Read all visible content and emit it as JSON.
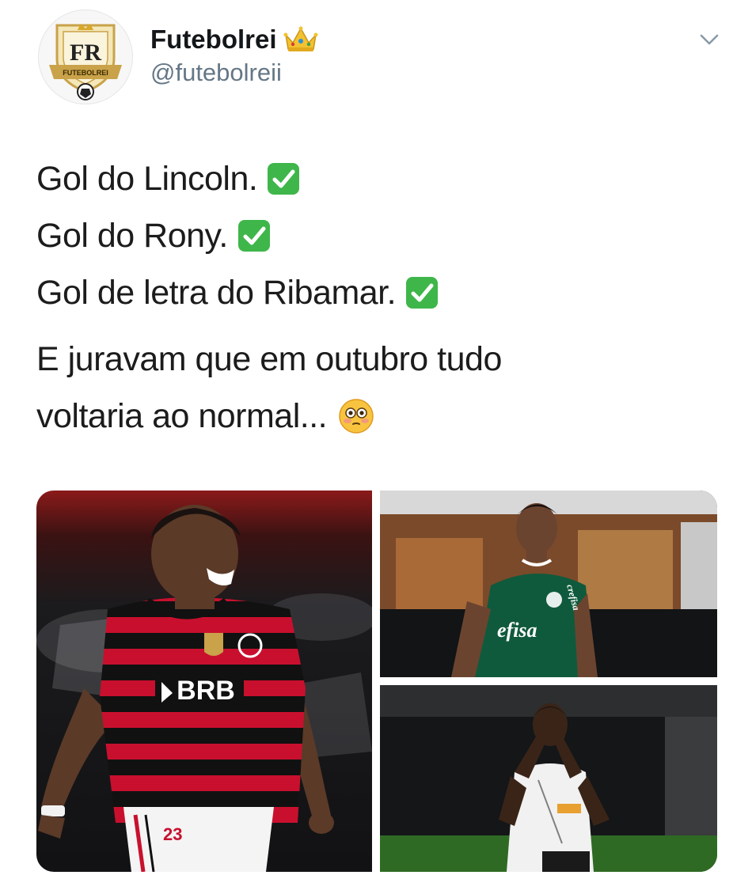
{
  "tweet": {
    "author": {
      "display_name": "Futebolrei",
      "handle": "@futebolreii",
      "avatar_label": "FUTEBOLREI",
      "name_emoji": "crown-icon"
    },
    "menu_icon": "chevron-down-icon",
    "lines": [
      {
        "text": "Gol do Lincoln.",
        "emoji": "check-mark-button-icon"
      },
      {
        "text": "Gol do Rony.",
        "emoji": "check-mark-button-icon"
      },
      {
        "text": "Gol de letra do Ribamar.",
        "emoji": "check-mark-button-icon"
      }
    ],
    "closing_lines": [
      {
        "text": "E juravam que em outubro tudo"
      },
      {
        "text": "voltaria ao normal...",
        "emoji": "flushed-face-icon"
      }
    ],
    "media": {
      "left": {
        "sponsor_text": "BRB",
        "shirt_number": "23"
      },
      "top_right": {
        "sponsor_text": "efisa",
        "sleeve_text": "crefisa"
      },
      "bottom_right": {}
    },
    "colors": {
      "name": "#14171a",
      "handle": "#657786",
      "text": "#1c1c1c",
      "check_green": "#3fb64a",
      "flamengo_red": "#c8102e",
      "palmeiras_green": "#0f5a3c"
    }
  }
}
